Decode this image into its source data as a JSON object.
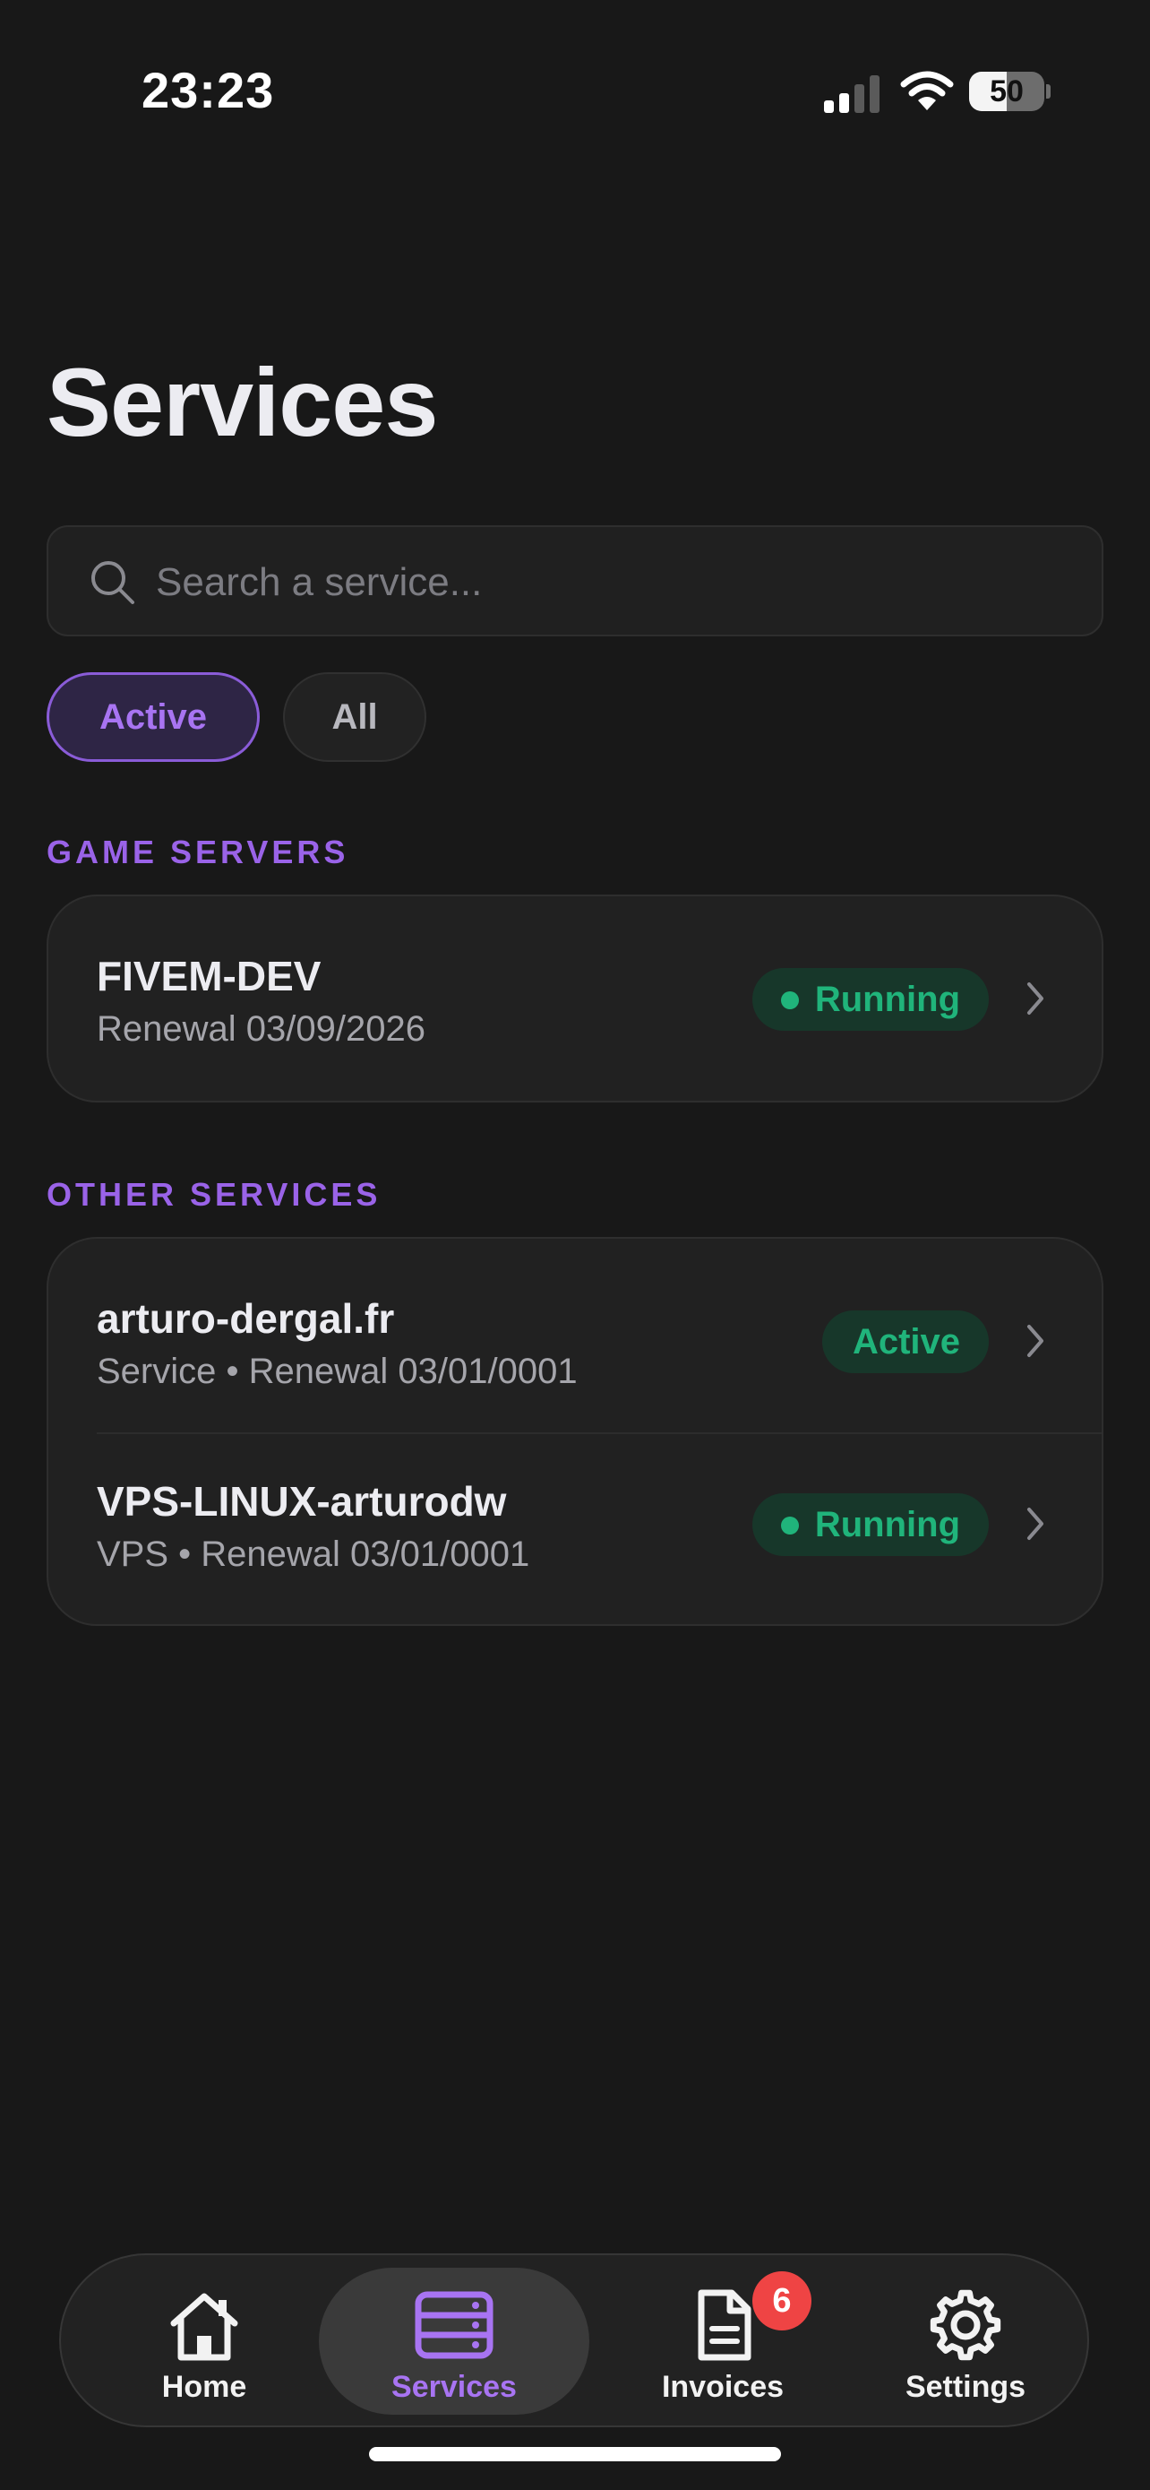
{
  "status_bar": {
    "time": "23:23",
    "battery_percent": "50",
    "battery_level": 0.5,
    "icons": [
      "signal-icon",
      "wifi-icon",
      "battery-icon"
    ]
  },
  "page": {
    "title": "Services"
  },
  "search": {
    "placeholder": "Search a service..."
  },
  "filters": [
    {
      "label": "Active",
      "selected": true
    },
    {
      "label": "All",
      "selected": false
    }
  ],
  "sections": [
    {
      "header": "GAME SERVERS",
      "items": [
        {
          "name": "FIVEM-DEV",
          "subtitle": "Renewal 03/09/2026",
          "status": "Running",
          "status_dot": true
        }
      ]
    },
    {
      "header": "OTHER SERVICES",
      "items": [
        {
          "name": "arturo-dergal.fr",
          "subtitle": "Service • Renewal 03/01/0001",
          "status": "Active",
          "status_dot": false
        },
        {
          "name": "VPS-LINUX-arturodw",
          "subtitle": "VPS • Renewal 03/01/0001",
          "status": "Running",
          "status_dot": true
        }
      ]
    }
  ],
  "tab_bar": {
    "tabs": [
      {
        "label": "Home",
        "icon": "house-icon",
        "active": false
      },
      {
        "label": "Services",
        "icon": "server-stack-icon",
        "active": true
      },
      {
        "label": "Invoices",
        "icon": "document-icon",
        "active": false,
        "badge": "6"
      },
      {
        "label": "Settings",
        "icon": "gear-icon",
        "active": false
      }
    ]
  },
  "colors": {
    "background": "#181818",
    "accent": "#a874f2",
    "status_green": "#20b47b",
    "badge_red": "#ef4444"
  }
}
